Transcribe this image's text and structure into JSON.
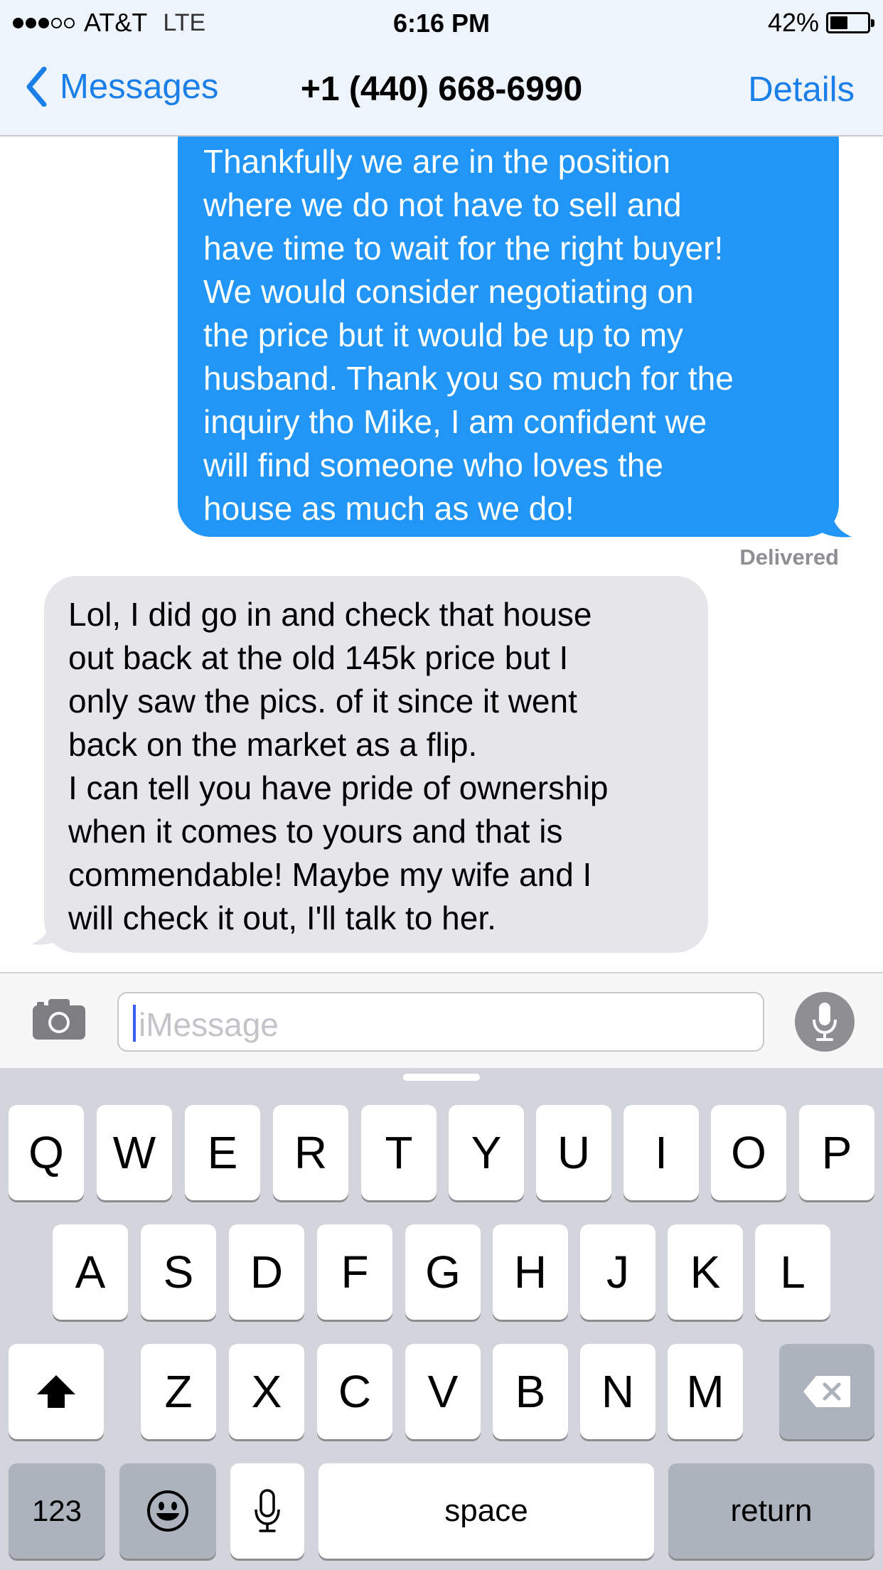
{
  "status_bar": {
    "carrier": "AT&T",
    "network": "LTE",
    "time": "6:16 PM",
    "battery": "42%",
    "battery_level": 0.42,
    "signal_bars": 3,
    "signal_total": 5
  },
  "nav": {
    "back_label": "Messages",
    "title": "+1 (440) 668-6990",
    "details_label": "Details"
  },
  "messages": {
    "sent": {
      "lines": [
        "Thankfully we are in the position",
        "where we do not have to sell and",
        "have time to wait for the right buyer!",
        "We would consider negotiating on",
        "the price but it would be up to my",
        "husband. Thank you so much for the",
        "inquiry tho Mike, I am confident we",
        "will find someone who loves the",
        "house as much as we do!"
      ],
      "status": "Delivered"
    },
    "received": {
      "lines": [
        "Lol, I did go in and check that house",
        "out back at the old 145k price but I",
        "only saw the pics. of it since it went",
        "back on the market as a flip.",
        "I can tell you have pride of ownership",
        "when it comes to yours and that is",
        "commendable! Maybe my wife and I",
        "will check it out, I'll talk to her."
      ]
    }
  },
  "compose": {
    "placeholder": "iMessage"
  },
  "keyboard": {
    "row1": [
      "Q",
      "W",
      "E",
      "R",
      "T",
      "Y",
      "U",
      "I",
      "O",
      "P"
    ],
    "row2": [
      "A",
      "S",
      "D",
      "F",
      "G",
      "H",
      "J",
      "K",
      "L"
    ],
    "row3": [
      "Z",
      "X",
      "C",
      "V",
      "B",
      "N",
      "M"
    ],
    "numbers_label": "123",
    "space_label": "space",
    "return_label": "return"
  },
  "colors": {
    "sent_bubble": "#2196f7",
    "received_bubble": "#e5e5ea",
    "accent": "#1a7fe8",
    "keyboard_bg": "#d2d5db"
  },
  "icons": {
    "back": "chevron-left-icon",
    "camera": "camera-icon",
    "mic": "microphone-icon",
    "shift": "shift-arrow-icon",
    "delete": "backspace-icon",
    "emoji": "smiley-icon",
    "dictation": "microphone-icon"
  }
}
